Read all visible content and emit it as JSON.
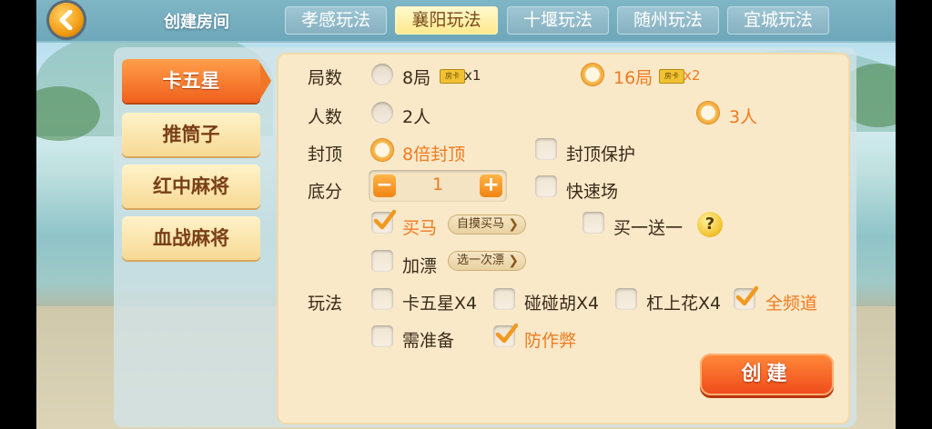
{
  "header": {
    "title": "创建房间"
  },
  "tabs": [
    {
      "label": "孝感玩法",
      "active": false
    },
    {
      "label": "襄阳玩法",
      "active": true
    },
    {
      "label": "十堰玩法",
      "active": false
    },
    {
      "label": "随州玩法",
      "active": false
    },
    {
      "label": "宜城玩法",
      "active": false
    }
  ],
  "sidebar": [
    {
      "label": "卡五星",
      "active": true
    },
    {
      "label": "推筒子",
      "active": false
    },
    {
      "label": "红中麻将",
      "active": false
    },
    {
      "label": "血战麻将",
      "active": false
    }
  ],
  "rows": {
    "rounds": {
      "label": "局数",
      "options": [
        {
          "label": "8局",
          "cost": "x1",
          "selected": false
        },
        {
          "label": "16局",
          "cost": "x2",
          "selected": true
        }
      ]
    },
    "players": {
      "label": "人数",
      "options": [
        {
          "label": "2人",
          "selected": false
        },
        {
          "label": "3人",
          "selected": true
        }
      ]
    },
    "cap": {
      "label": "封顶",
      "options": [
        {
          "label": "8倍封顶",
          "selected": true
        },
        {
          "label": "封顶保护",
          "checked": false
        }
      ]
    },
    "base": {
      "label": "底分",
      "value": "1",
      "fast_label": "快速场",
      "fast_checked": false
    },
    "buy_horse": {
      "label": "买马",
      "checked": true,
      "button": "自摸买马",
      "extra_label": "买一送一",
      "extra_checked": false,
      "help": "?"
    },
    "float": {
      "label": "加漂",
      "checked": false,
      "button": "选一次漂"
    },
    "rules": {
      "label": "玩法",
      "options": [
        {
          "label": "卡五星X4",
          "checked": false
        },
        {
          "label": "碰碰胡X4",
          "checked": false
        },
        {
          "label": "杠上花X4",
          "checked": false
        },
        {
          "label": "全频道",
          "checked": true
        },
        {
          "label": "需准备",
          "checked": false
        },
        {
          "label": "防作弊",
          "checked": true
        }
      ]
    }
  },
  "create_button": "创建",
  "colors": {
    "accent": "#f07a20",
    "panel": "#f9e9c8",
    "tab_active": "#ffe98b"
  }
}
